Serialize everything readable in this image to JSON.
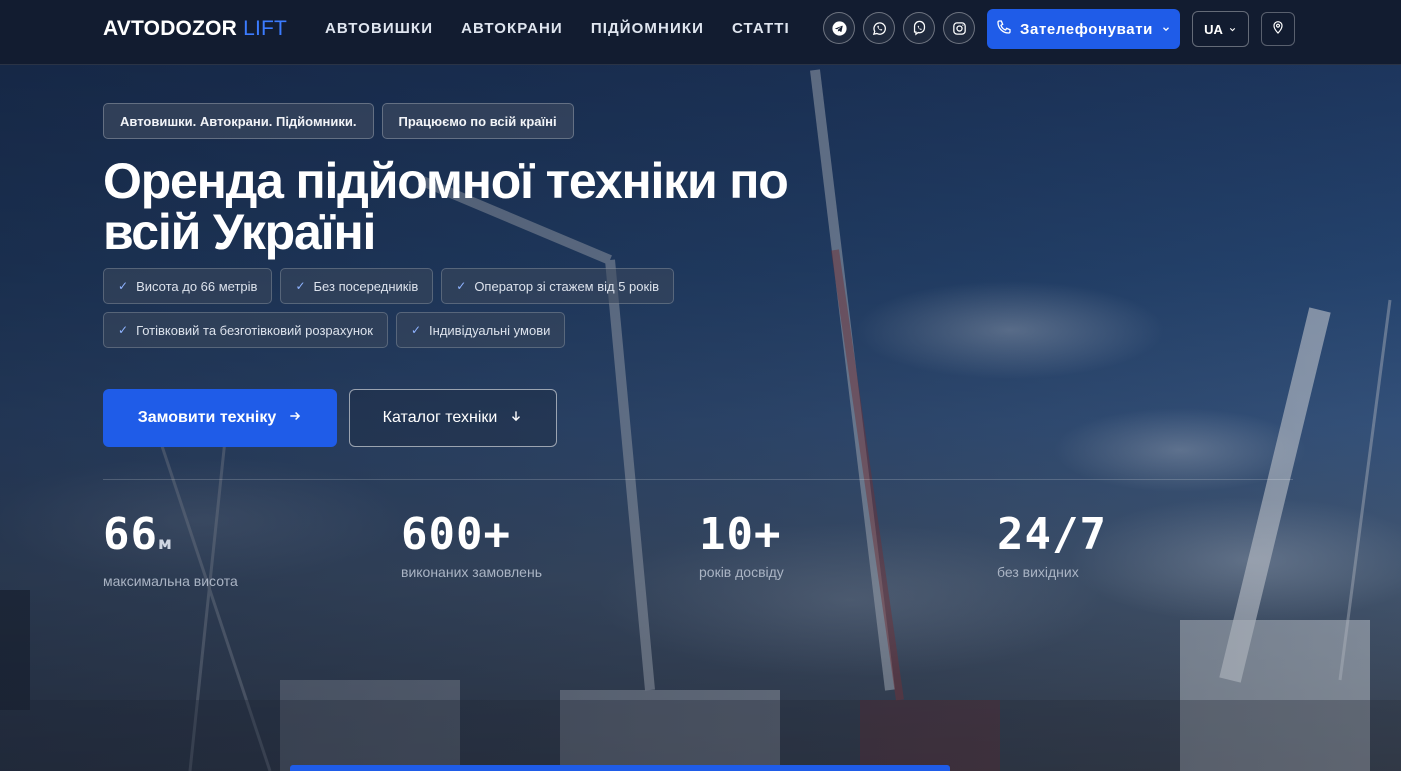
{
  "header": {
    "logo_main": "AVTODOZOR",
    "logo_accent": "LIFT",
    "nav": [
      "АВТОВИШКИ",
      "АВТОКРАНИ",
      "ПІДЙОМНИКИ",
      "СТАТТІ"
    ],
    "socials": [
      "telegram-icon",
      "whatsapp-icon",
      "viber-icon",
      "instagram-icon"
    ],
    "call_label": "Зателефонувати",
    "lang_label": "UA"
  },
  "hero": {
    "tags": [
      "Автовишки. Автокрани. Підйомники.",
      "Працюємо по всій країні"
    ],
    "title_line1": "Оренда підйомної техніки по",
    "title_line2": "всій Україні",
    "features": [
      "Висота до 66 метрів",
      "Без посередників",
      "Оператор зі стажем від 5 років",
      "Готівковий та безготівковий розрахунок",
      "Індивідуальні умови"
    ],
    "cta_primary": "Замовити техніку",
    "cta_secondary": "Каталог техніки"
  },
  "stats": [
    {
      "value": "66",
      "unit": "м",
      "label": "максимальна висота"
    },
    {
      "value": "600+",
      "unit": "",
      "label": "виконаних замовлень"
    },
    {
      "value": "10+",
      "unit": "",
      "label": "років досвіду"
    },
    {
      "value": "24/7",
      "unit": "",
      "label": "без вихідних"
    }
  ],
  "colors": {
    "accent": "#1f5ce8",
    "logo_accent": "#3b7bff",
    "header_bg": "#121c30"
  }
}
